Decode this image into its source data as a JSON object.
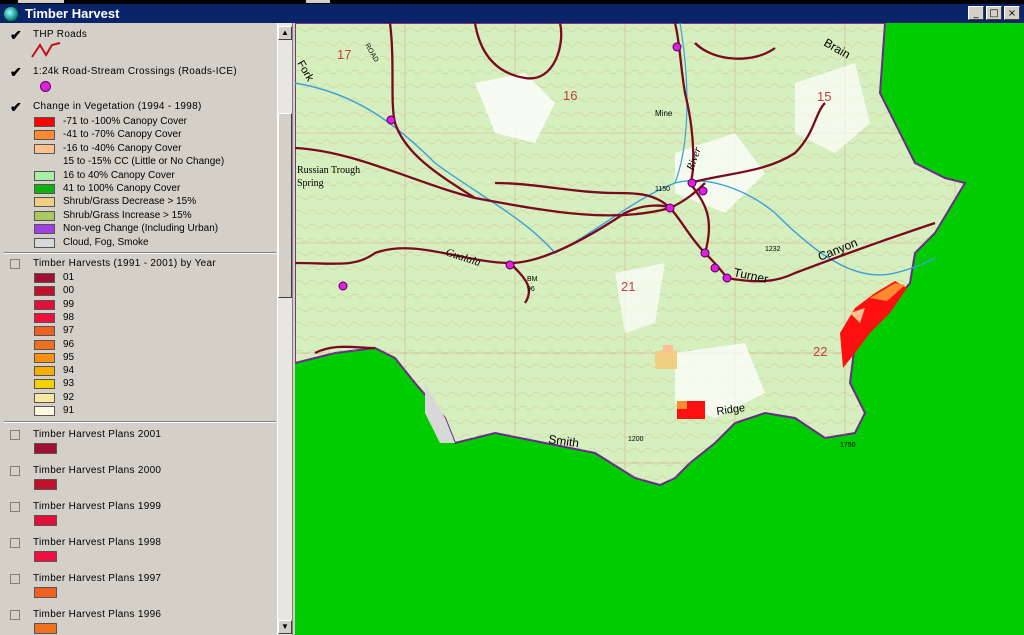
{
  "window": {
    "title": "Timber Harvest",
    "buttons": [
      "_",
      "□",
      "×"
    ]
  },
  "toc": {
    "layers": [
      {
        "name": "THP Roads",
        "checked": true
      },
      {
        "name": "1:24k Road-Stream Crossings (Roads-ICE)",
        "checked": true
      },
      {
        "name": "Change in Vegetation (1994 - 1998)",
        "checked": true
      },
      {
        "name": "Timber Harvests (1991 - 2001) by Year",
        "checked": false
      }
    ],
    "veg_classes": [
      {
        "label": "-71 to -100% Canopy Cover",
        "color": "#ff0000"
      },
      {
        "label": "-41 to -70% Canopy Cover",
        "color": "#ff8a30"
      },
      {
        "label": "-16 to -40% Canopy Cover",
        "color": "#ffc090"
      },
      {
        "label": "15 to -15% CC (Little or No Change)",
        "color": ""
      },
      {
        "label": "16 to 40% Canopy Cover",
        "color": "#a8f0a8"
      },
      {
        "label": "41 to 100% Canopy Cover",
        "color": "#10b010"
      },
      {
        "label": "Shrub/Grass Decrease > 15%",
        "color": "#f0d080"
      },
      {
        "label": "Shrub/Grass Increase > 15%",
        "color": "#a8c860"
      },
      {
        "label": "Non-veg Change (Including Urban)",
        "color": "#a040e0"
      },
      {
        "label": "Cloud, Fog, Smoke",
        "color": "#d8d8d8"
      }
    ],
    "harvest_years": [
      {
        "label": "01",
        "color": "#a01030"
      },
      {
        "label": "00",
        "color": "#c0102a"
      },
      {
        "label": "99",
        "color": "#e0103a"
      },
      {
        "label": "98",
        "color": "#f01040"
      },
      {
        "label": "97",
        "color": "#f06020"
      },
      {
        "label": "96",
        "color": "#f07020"
      },
      {
        "label": "95",
        "color": "#f89010"
      },
      {
        "label": "94",
        "color": "#f8b000"
      },
      {
        "label": "93",
        "color": "#f8d000"
      },
      {
        "label": "92",
        "color": "#f8e8a0"
      },
      {
        "label": "91",
        "color": "#fff8e0"
      }
    ],
    "plans": [
      {
        "name": "Timber Harvest Plans 2001",
        "color": "#a01030"
      },
      {
        "name": "Timber Harvest Plans 2000",
        "color": "#c0102a"
      },
      {
        "name": "Timber Harvest Plans 1999",
        "color": "#e0103a"
      },
      {
        "name": "Timber Harvest Plans 1998",
        "color": "#f01040"
      },
      {
        "name": "Timber Harvest Plans 1997",
        "color": "#f06020"
      },
      {
        "name": "Timber Harvest Plans 1996",
        "color": "#f07020"
      }
    ]
  },
  "map": {
    "labels": {
      "brain": "Brain",
      "russian": "Russian Trough",
      "spring": "Spring",
      "gualala": "Gualala",
      "river": "River",
      "turner": "Turner",
      "canyon": "Canyon",
      "smith": "Smith",
      "ridge": "Ridge",
      "mine": "Mine",
      "road": "ROAD",
      "fork": "Fork",
      "bm": "BM",
      "bm_val": "96",
      "sec17": "17",
      "sec16": "16",
      "sec15": "15",
      "sec21": "21",
      "sec22": "22",
      "e1150": "1150",
      "e1232": "1232",
      "e1200": "1200",
      "e1750": "1750"
    },
    "colors": {
      "background": "#00cc00",
      "terrain": "#d8f0c0",
      "road": "#800020",
      "boundary": "#6a2a8a"
    }
  }
}
